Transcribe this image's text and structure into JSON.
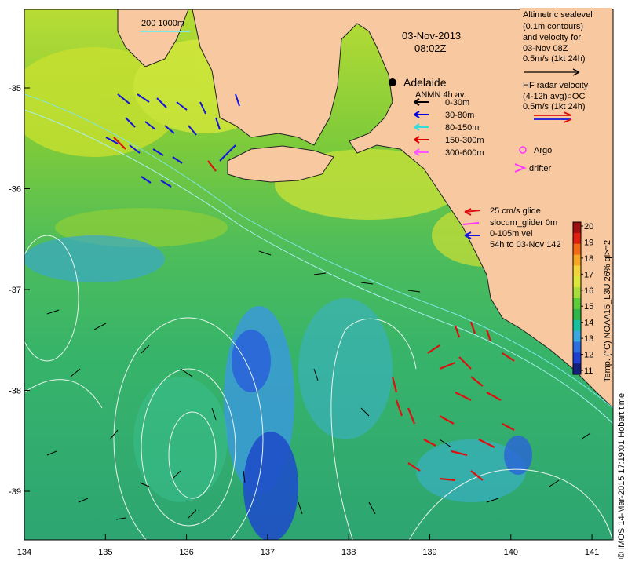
{
  "map": {
    "date": "03-Nov-2013",
    "time": "08:02Z",
    "city": "Adelaide",
    "scale_bar": "200  1000m",
    "lon_ticks": [
      "134",
      "135",
      "136",
      "137",
      "138",
      "139",
      "140",
      "141"
    ],
    "lat_ticks": [
      "-35",
      "-36",
      "-37",
      "-38",
      "-39"
    ],
    "footer": "© IMOS 14-Mar-2015 17:19:01 Hobart time"
  },
  "legend": {
    "altimetry": [
      "Altimetric sealevel",
      "(0.1m contours)",
      "and velocity for",
      "03-Nov 08Z",
      "0.5m/s (1kt 24h)"
    ],
    "hf_radar": [
      "HF radar velocity",
      "(4-12h avg)○OC",
      "0.5m/s (1kt 24h)"
    ],
    "anmn_title": "ANMN 4h av.",
    "anmn_items": [
      {
        "label": "0-30m",
        "color": "#000000"
      },
      {
        "label": "30-80m",
        "color": "#0000dd"
      },
      {
        "label": "80-150m",
        "color": "#33dddd"
      },
      {
        "label": "150-300m",
        "color": "#dd0000"
      },
      {
        "label": "300-600m",
        "color": "#ff55ff"
      }
    ],
    "argo": "Argo",
    "drifter": "drifter",
    "glider": [
      "25 cm/s glide",
      "slocum_glider 0m",
      "0-105m vel",
      "54h to 03-Nov 142"
    ]
  },
  "colorbar": {
    "label": "Temp. (°C) NOAA15_L3U 26% ql>=2",
    "ticks": [
      "20",
      "19",
      "18",
      "17",
      "16",
      "15",
      "14",
      "13",
      "12",
      "11"
    ],
    "colors": [
      "#a01010",
      "#e02010",
      "#f26a14",
      "#f5a623",
      "#f3d33a",
      "#dbe83a",
      "#a8dc3a",
      "#5ecb3c",
      "#2fb54a",
      "#19c0a0",
      "#3aa8e0",
      "#2e6ee0",
      "#1e3fcf",
      "#14207a"
    ]
  },
  "colors": {
    "land": "#f8c8a0",
    "cold_sst": "#2f6fd8",
    "warm_sst": "#a8d83a"
  }
}
